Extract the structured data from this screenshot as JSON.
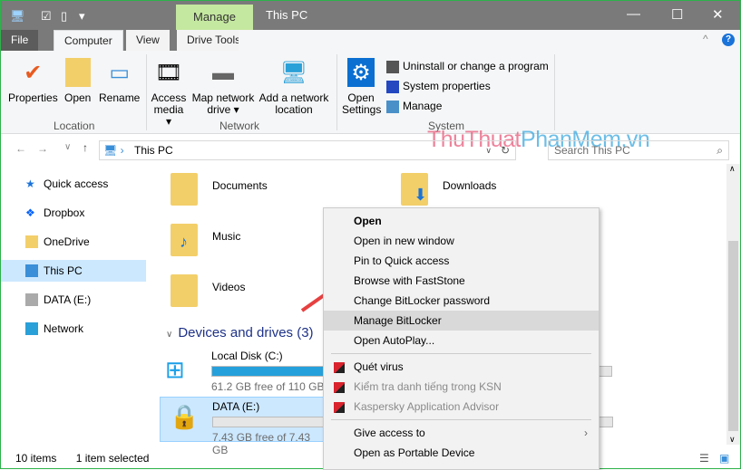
{
  "window": {
    "title": "This PC",
    "context_tab": "Manage"
  },
  "tabs": [
    {
      "label": "File"
    },
    {
      "label": "Computer"
    },
    {
      "label": "View"
    },
    {
      "label": "Drive Tools"
    }
  ],
  "ribbon": {
    "location": {
      "label": "Location",
      "buttons": [
        "Properties",
        "Open",
        "Rename"
      ]
    },
    "network": {
      "label": "Network",
      "buttons": [
        "Access media ▾",
        "Map network drive ▾",
        "Add a network location"
      ]
    },
    "system": {
      "label": "System",
      "open_settings": "Open Settings",
      "items": [
        "Uninstall or change a program",
        "System properties",
        "Manage"
      ]
    }
  },
  "watermark": {
    "part1": "ThuThuat",
    "part2": "PhanMem.vn"
  },
  "address": {
    "path": "This PC",
    "search_placeholder": "Search This PC"
  },
  "sidebar": {
    "items": [
      {
        "label": "Quick access"
      },
      {
        "label": "Dropbox"
      },
      {
        "label": "OneDrive"
      },
      {
        "label": "This PC"
      },
      {
        "label": "DATA (E:)"
      },
      {
        "label": "Network"
      }
    ]
  },
  "folders": [
    {
      "name": "Documents"
    },
    {
      "name": "Downloads"
    },
    {
      "name": "Music"
    },
    {
      "name": "Videos"
    }
  ],
  "devices": {
    "header": "Devices and drives (3)",
    "drives": [
      {
        "name": "Local Disk (C:)",
        "free": "61.2 GB free of 110 GB",
        "used_fraction": 0.44
      },
      {
        "name": "DATA (E:)",
        "free": "7.43 GB free of 7.43 GB",
        "used_fraction": 0.0
      }
    ]
  },
  "context_menu": {
    "items": [
      "Open",
      "Open in new window",
      "Pin to Quick access",
      "Browse with FastStone",
      "Change BitLocker password",
      "Manage BitLocker",
      "Open AutoPlay...",
      "Quét virus",
      "Kiểm tra danh tiếng trong KSN",
      "Kaspersky Application Advisor",
      "Give access to",
      "Open as Portable Device"
    ]
  },
  "status": {
    "items": "10 items",
    "selected": "1 item selected"
  }
}
